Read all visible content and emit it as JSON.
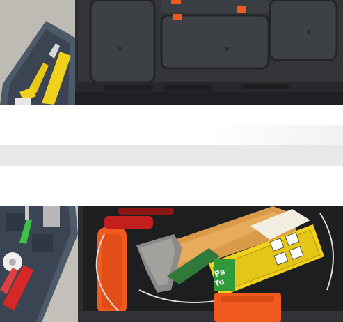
{
  "image": {
    "kind": "photograph",
    "subject": "toolbox",
    "palette": {
      "floor": "#bfbdb7",
      "plastic_dark": "#2b2d30",
      "plastic_mid": "#3c3f43",
      "latch_orange": "#f05a1e",
      "handle_wood": "#d99a4a",
      "yellow_label": "#f0d21e",
      "blue_grey_tray": "#4d5a6a",
      "white_band": "#ffffff",
      "grey_band": "#e9e9e9"
    }
  },
  "label_sticker": {
    "text": "Pa\nTu"
  }
}
